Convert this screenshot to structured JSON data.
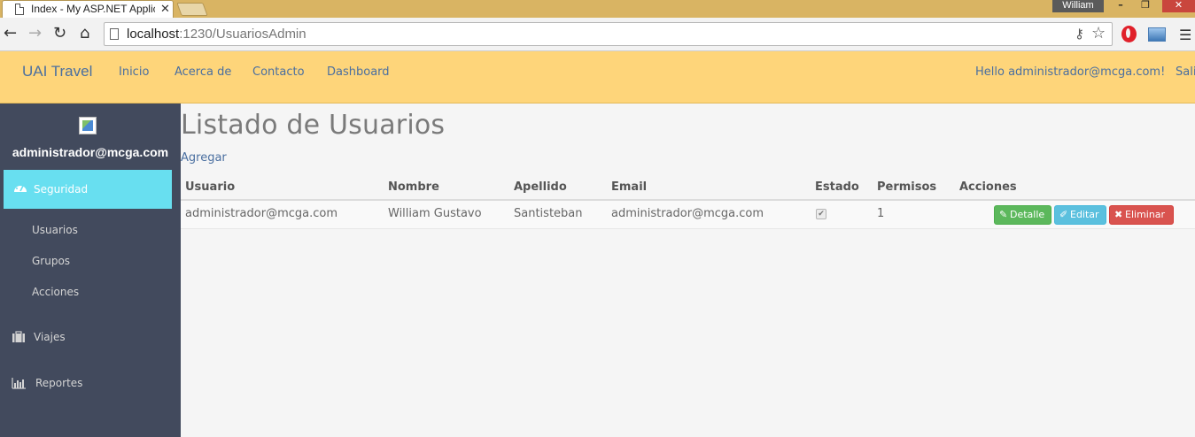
{
  "browser": {
    "tab_title": "Index - My ASP.NET Applic",
    "tab_close": "✕",
    "profile_name": "William",
    "window_minimize": "–",
    "window_maximize": "❐",
    "window_close": "✕",
    "url_host": "localhost",
    "url_path": ":1230/UsuariosAdmin",
    "nav_back": "←",
    "nav_forward": "→",
    "nav_reload": "↻",
    "nav_home": "⌂",
    "key_icon": "⚷",
    "star_icon": "☆",
    "menu_icon": "☰"
  },
  "navbar": {
    "brand": "UAI Travel",
    "links": [
      "Inicio",
      "Acerca de",
      "Contacto",
      "Dashboard"
    ],
    "hello": "Hello administrador@mcga.com!",
    "logout": "Sali",
    "background": "#fed57a",
    "link_color": "#4a6fa0"
  },
  "sidebar": {
    "user": "administrador@mcga.com",
    "active_section": "Seguridad",
    "sub_items": [
      "Usuarios",
      "Grupos",
      "Acciones"
    ],
    "items": [
      "Viajes",
      "Reportes"
    ],
    "background": "#424a5d",
    "active_color": "#68dff0"
  },
  "main": {
    "title": "Listado de Usuarios",
    "add_link": "Agregar",
    "columns": [
      "Usuario",
      "Nombre",
      "Apellido",
      "Email",
      "Estado",
      "Permisos",
      "Acciones"
    ],
    "rows": [
      {
        "usuario": "administrador@mcga.com",
        "nombre": "William Gustavo",
        "apellido": "Santisteban",
        "email": "administrador@mcga.com",
        "estado_checked": true,
        "permisos": "1",
        "actions": [
          "Detalle",
          "Editar",
          "Eliminar"
        ]
      }
    ],
    "button_colors": {
      "detalle": "#5cb85c",
      "editar": "#5bc0de",
      "eliminar": "#d9534f"
    }
  }
}
